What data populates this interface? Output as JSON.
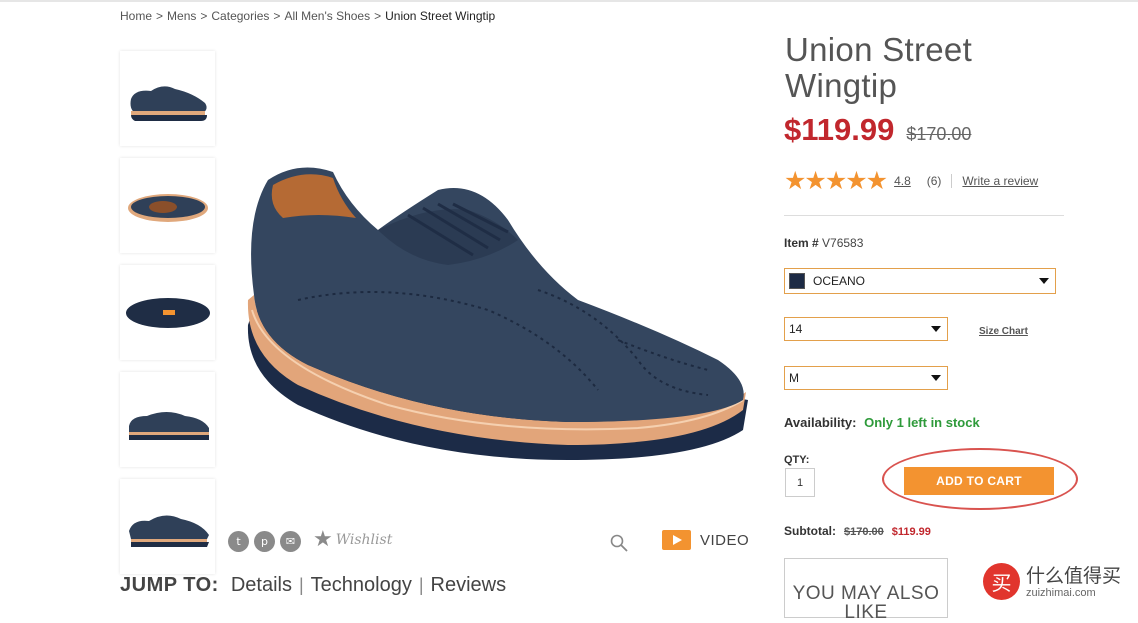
{
  "breadcrumb": {
    "items": [
      "Home",
      "Mens",
      "Categories",
      "All Men's Shoes"
    ],
    "current": "Union Street Wingtip",
    "separator": ">"
  },
  "product": {
    "title": "Union Street Wingtip",
    "price": "$119.99",
    "was_price": "$170.00",
    "rating": {
      "stars_glyph": "★★★★★",
      "value": "4.8",
      "count": "(6)",
      "write_review": "Write a review"
    },
    "item_label": "Item #",
    "item_number": "V76583",
    "color": {
      "value": "OCEANO",
      "swatch": "#1d2b45"
    },
    "size": {
      "value": "14"
    },
    "width": {
      "value": "M"
    },
    "size_chart": "Size Chart",
    "availability": {
      "label": "Availability:",
      "value": "Only 1 left in stock"
    },
    "qty": {
      "label": "QTY:",
      "value": "1"
    },
    "add_to_cart": "ADD TO CART",
    "subtotal": {
      "label": "Subtotal:",
      "was": "$170.00",
      "now": "$119.99"
    },
    "you_may_also_like": "YOU MAY ALSO LIKE"
  },
  "media": {
    "share_icons": [
      "twitter-icon",
      "pinterest-icon",
      "email-icon"
    ],
    "wishlist": "Wishlist",
    "video": "VIDEO"
  },
  "jump_to": {
    "label": "JUMP TO:",
    "links": [
      "Details",
      "Technology",
      "Reviews"
    ]
  },
  "watermark": {
    "cn": "什么值得买",
    "en": "zuizhimai.com",
    "logo_char": "买"
  },
  "colors": {
    "accent_orange": "#f39330",
    "price_red": "#c1272d",
    "in_stock_green": "#2e9a3a",
    "shoe_navy": "#2f4058"
  }
}
